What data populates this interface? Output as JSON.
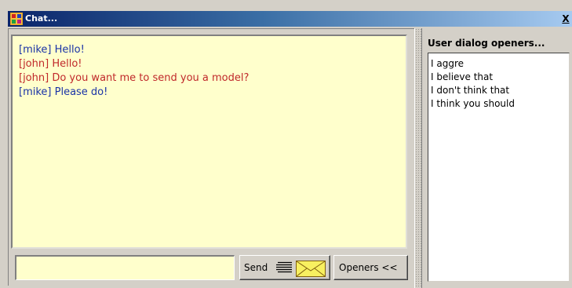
{
  "window": {
    "title": "Chat...",
    "close_label": "X"
  },
  "colors": {
    "mike": "#1a33a6",
    "john": "#c0282a",
    "chat_bg": "#ffffcc"
  },
  "chat": {
    "messages": [
      {
        "speaker": "mike",
        "text": "[mike] Hello!"
      },
      {
        "speaker": "john",
        "text": "[john] Hello!"
      },
      {
        "speaker": "john",
        "text": "[john] Do you want me to send you a model?"
      },
      {
        "speaker": "mike",
        "text": "[mike] Please do!"
      }
    ]
  },
  "input": {
    "value": "",
    "placeholder": ""
  },
  "buttons": {
    "send_label": "Send",
    "send_icons": [
      "lines-icon",
      "envelope-icon"
    ],
    "openers_label": "Openers <<"
  },
  "openers": {
    "title": "User dialog openers...",
    "items": [
      "I aggre",
      "I believe that",
      "I don't think that",
      "I think you should"
    ]
  }
}
